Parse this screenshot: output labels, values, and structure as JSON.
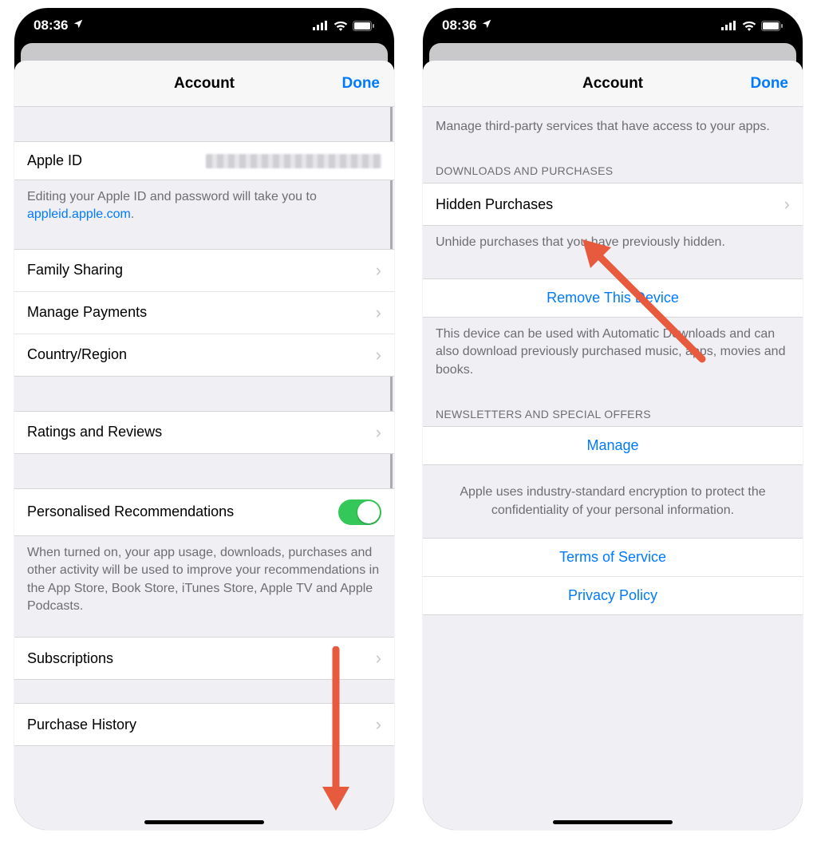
{
  "statusbar": {
    "time": "08:36"
  },
  "sheet": {
    "title": "Account",
    "done": "Done"
  },
  "left": {
    "apple_id_label": "Apple ID",
    "apple_id_note_pre": "Editing your Apple ID and password will take you to ",
    "apple_id_note_link": "appleid.apple.com",
    "family_sharing": "Family Sharing",
    "manage_payments": "Manage Payments",
    "country_region": "Country/Region",
    "ratings_reviews": "Ratings and Reviews",
    "personalised": "Personalised Recommendations",
    "personalised_note": "When turned on, your app usage, downloads, purchases and other activity will be used to improve your recommendations in the App Store, Book Store, iTunes Store, Apple TV and Apple Podcasts.",
    "subscriptions": "Subscriptions",
    "purchase_history": "Purchase History"
  },
  "right": {
    "apps_access_note": "Manage third-party services that have access to your apps.",
    "downloads_header": "DOWNLOADS AND PURCHASES",
    "hidden_purchases": "Hidden Purchases",
    "hidden_note": "Unhide purchases that you have previously hidden.",
    "remove_device": "Remove This Device",
    "remove_note": "This device can be used with Automatic Downloads and can also download previously purchased music, apps, movies and books.",
    "newsletters_header": "NEWSLETTERS AND SPECIAL OFFERS",
    "manage": "Manage",
    "encryption_note": "Apple uses industry-standard encryption to protect the confidentiality of your personal information.",
    "terms": "Terms of Service",
    "privacy": "Privacy Policy"
  }
}
